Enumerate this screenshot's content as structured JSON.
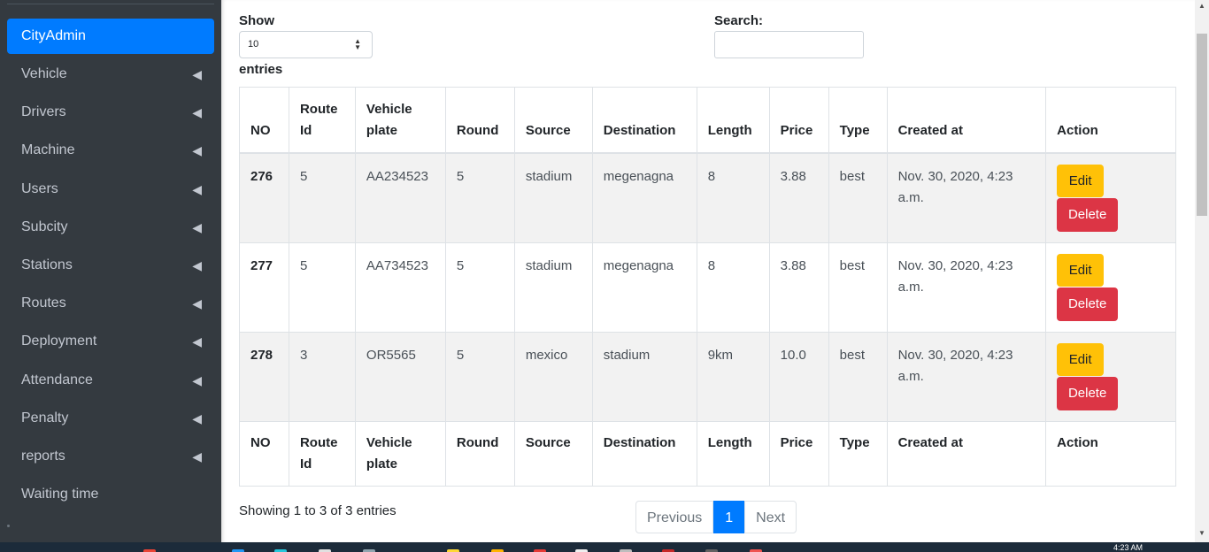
{
  "sidebar": {
    "active": "CityAdmin",
    "items": [
      {
        "label": "Vehicle",
        "chevron": true
      },
      {
        "label": "Drivers",
        "chevron": true
      },
      {
        "label": "Machine",
        "chevron": true
      },
      {
        "label": "Users",
        "chevron": true
      },
      {
        "label": "Subcity",
        "chevron": true
      },
      {
        "label": "Stations",
        "chevron": true
      },
      {
        "label": "Routes",
        "chevron": true
      },
      {
        "label": "Deployment",
        "chevron": true
      },
      {
        "label": "Attendance",
        "chevron": true
      },
      {
        "label": "Penalty",
        "chevron": true
      },
      {
        "label": "reports",
        "chevron": true
      },
      {
        "label": "Waiting time",
        "chevron": false
      }
    ],
    "chevron_icon": "chevron-left-icon"
  },
  "controls": {
    "show_label": "Show",
    "entries_value": "10",
    "entries_label": "entries",
    "search_label": "Search:",
    "search_value": ""
  },
  "table": {
    "headers": [
      {
        "line1": "NO",
        "line2": ""
      },
      {
        "line1": "Route",
        "line2": "Id"
      },
      {
        "line1": "Vehicle",
        "line2": "plate"
      },
      {
        "line1": "Round",
        "line2": ""
      },
      {
        "line1": "Source",
        "line2": ""
      },
      {
        "line1": "Destination",
        "line2": ""
      },
      {
        "line1": "Length",
        "line2": ""
      },
      {
        "line1": "Price",
        "line2": ""
      },
      {
        "line1": "Type",
        "line2": ""
      },
      {
        "line1": "Created at",
        "line2": ""
      },
      {
        "line1": "Action",
        "line2": ""
      }
    ],
    "rows": [
      {
        "no": "276",
        "route_id": "5",
        "plate": "AA234523",
        "round": "5",
        "source": "stadium",
        "destination": "megenagna",
        "length": "8",
        "price": "3.88",
        "type": "best",
        "created_at": "Nov. 30, 2020, 4:23 a.m."
      },
      {
        "no": "277",
        "route_id": "5",
        "plate": "AA734523",
        "round": "5",
        "source": "stadium",
        "destination": "megenagna",
        "length": "8",
        "price": "3.88",
        "type": "best",
        "created_at": "Nov. 30, 2020, 4:23 a.m."
      },
      {
        "no": "278",
        "route_id": "3",
        "plate": "OR5565",
        "round": "5",
        "source": "mexico",
        "destination": "stadium",
        "length": "9km",
        "price": "10.0",
        "type": "best",
        "created_at": "Nov. 30, 2020, 4:23 a.m."
      }
    ],
    "edit_label": "Edit",
    "delete_label": "Delete"
  },
  "footer": {
    "info": "Showing 1 to 3 of 3 entries",
    "prev_label": "Previous",
    "current_page": "1",
    "next_label": "Next"
  },
  "taskbar": {
    "clock": "4:23 AM"
  },
  "colors": {
    "sidebar_bg": "#343a40",
    "accent": "#007bff",
    "edit": "#ffc107",
    "delete": "#dc3545"
  }
}
